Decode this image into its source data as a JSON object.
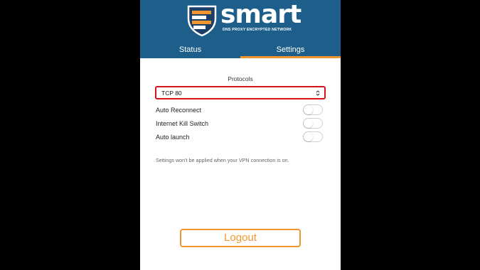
{
  "header": {
    "logo_word": "smart",
    "logo_tagline": "DNS PROXY ENCRYPTED NETWORK",
    "tabs": [
      {
        "label": "Status",
        "active": false
      },
      {
        "label": "Settings",
        "active": true
      }
    ]
  },
  "settings": {
    "protocols_label": "Protocols",
    "protocol_select": {
      "value": "TCP 80"
    },
    "toggles": [
      {
        "label": "Auto Reconnect",
        "on": false
      },
      {
        "label": "Internet Kill Switch",
        "on": false
      },
      {
        "label": "Auto launch",
        "on": false
      }
    ],
    "note": "Settings won't be applied when your VPN connection is on."
  },
  "footer": {
    "logout_label": "Logout"
  },
  "colors": {
    "header_bg": "#1d5f8a",
    "accent": "#f1962e",
    "highlight_border": "#d8131b"
  }
}
